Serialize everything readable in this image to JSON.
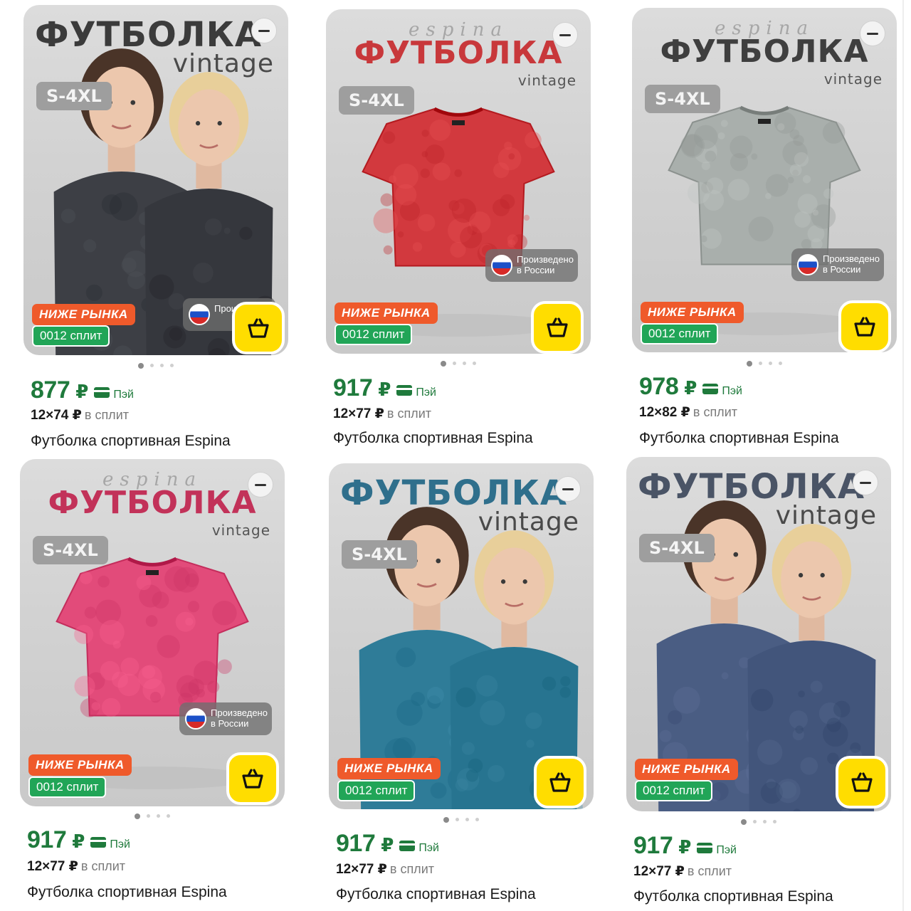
{
  "products": [
    {
      "brand_script": "",
      "headline": "ФУТБОЛКА",
      "headline_color": "#3b3b3b",
      "vintage": "vintage",
      "size_range": "S-4XL",
      "made_in": "Произ в Рос",
      "below_market": "НИЖЕ РЫНКА",
      "split_badge": "0012 сплит",
      "price": "877",
      "currency": "₽",
      "pay_label": "Пэй",
      "split_amount": "12×74 ₽",
      "split_suffix": "в сплит",
      "title": "Футболка спортивная Espina",
      "shirt_color": "#3d3f45",
      "scene": "couple"
    },
    {
      "brand_script": "espina",
      "headline": "ФУТБОЛКА",
      "headline_color": "#c8383b",
      "vintage": "vintage",
      "size_range": "S-4XL",
      "made_in": "Произведено в России",
      "below_market": "НИЖЕ РЫНКА",
      "split_badge": "0012 сплит",
      "price": "917",
      "currency": "₽",
      "pay_label": "Пэй",
      "split_amount": "12×77 ₽",
      "split_suffix": "в сплит",
      "title": "Футболка спортивная Espina",
      "shirt_color": "#d2393e",
      "scene": "shirt"
    },
    {
      "brand_script": "espina",
      "headline": "ФУТБОЛКА",
      "headline_color": "#3f3f3f",
      "vintage": "vintage",
      "size_range": "S-4XL",
      "made_in": "Произведено в России",
      "below_market": "НИЖЕ РЫНКА",
      "split_badge": "0012 сплит",
      "price": "978",
      "currency": "₽",
      "pay_label": "Пэй",
      "split_amount": "12×82 ₽",
      "split_suffix": "в сплит",
      "title": "Футболка спортивная Espina",
      "shirt_color": "#a9afac",
      "scene": "shirt"
    },
    {
      "brand_script": "espina",
      "headline": "ФУТБОЛКА",
      "headline_color": "#c23259",
      "vintage": "vintage",
      "size_range": "S-4XL",
      "made_in": "Произведено в России",
      "below_market": "НИЖЕ РЫНКА",
      "split_badge": "0012 сплит",
      "price": "917",
      "currency": "₽",
      "pay_label": "Пэй",
      "split_amount": "12×77 ₽",
      "split_suffix": "в сплит",
      "title": "Футболка спортивная Espina",
      "shirt_color": "#e24b7a",
      "scene": "shirt"
    },
    {
      "brand_script": "",
      "headline": "ФУТБОЛКА",
      "headline_color": "#2f6f8c",
      "vintage": "vintage",
      "size_range": "S-4XL",
      "made_in": "",
      "below_market": "НИЖЕ РЫНКА",
      "split_badge": "0012 сплит",
      "price": "917",
      "currency": "₽",
      "pay_label": "Пэй",
      "split_amount": "12×77 ₽",
      "split_suffix": "в сплит",
      "title": "Футболка спортивная Espina",
      "shirt_color": "#2f7c98",
      "scene": "couple"
    },
    {
      "brand_script": "",
      "headline": "ФУТБОЛКА",
      "headline_color": "#4a5466",
      "vintage": "vintage",
      "size_range": "S-4XL",
      "made_in": "",
      "below_market": "НИЖЕ РЫНКА",
      "split_badge": "0012 сплит",
      "price": "917",
      "currency": "₽",
      "pay_label": "Пэй",
      "split_amount": "12×77 ₽",
      "split_suffix": "в сплит",
      "title": "Футболка спортивная Espina",
      "shirt_color": "#4a5d83",
      "scene": "couple"
    }
  ]
}
